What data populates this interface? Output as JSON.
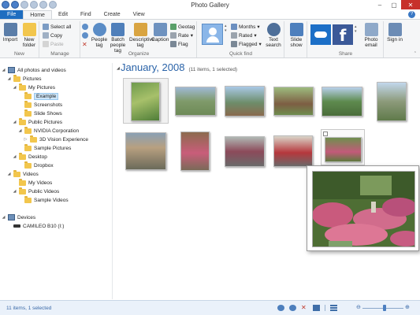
{
  "window": {
    "title": "Photo Gallery"
  },
  "tabs": [
    "File",
    "Home",
    "Edit",
    "Find",
    "Create",
    "View"
  ],
  "ribbon": {
    "new_group": {
      "name": "New",
      "import": "Import",
      "new_folder": "New folder"
    },
    "manage": {
      "name": "Manage",
      "select_all": "Select all",
      "copy": "Copy",
      "paste": "Paste"
    },
    "organize": {
      "name": "Organize",
      "people_tag": "People tag",
      "batch_people_tag": "Batch people tag",
      "descriptive_tag": "Descriptive tag",
      "caption": "Caption",
      "geotag": "Geotag",
      "rate": "Rate",
      "flag": "Flag"
    },
    "quick_find": {
      "name": "Quick find",
      "months": "Months",
      "rated": "Rated",
      "flagged": "Flagged",
      "text_search": "Text search"
    },
    "slideshow": {
      "label": "Slide show"
    },
    "share": {
      "name": "Share",
      "photo_email": "Photo email"
    },
    "signin": {
      "label": "Sign in"
    }
  },
  "nav": {
    "root": "All photos and videos",
    "pictures": "Pictures",
    "my_pictures": "My Pictures",
    "example": "Example",
    "screenshots": "Screenshots",
    "slide_shows": "Slide Shows",
    "public_pictures": "Public Pictures",
    "nvidia": "NVIDIA Corporation",
    "vision": "3D Vision Experience",
    "sample_pictures": "Sample Pictures",
    "desktop": "Desktop",
    "dropbox": "Dropbox",
    "videos": "Videos",
    "my_videos": "My Videos",
    "public_videos": "Public Videos",
    "sample_videos": "Sample Videos",
    "devices": "Devices",
    "camileo": "CAMILEO B10 (I:)"
  },
  "gallery": {
    "date": "January, 2008",
    "count": "(11 items, 1 selected)",
    "photos": [
      "photo-1",
      "photo-2",
      "photo-3",
      "photo-4",
      "photo-5",
      "photo-6",
      "photo-7",
      "photo-8",
      "photo-9",
      "photo-10",
      "photo-11"
    ]
  },
  "status": {
    "text": "11 items, 1 selected",
    "zoom": 0.55
  },
  "colors": {
    "accent": "#1e6dc0",
    "date_header": "#2a63a8",
    "status_bg": "#eaf1fa"
  }
}
